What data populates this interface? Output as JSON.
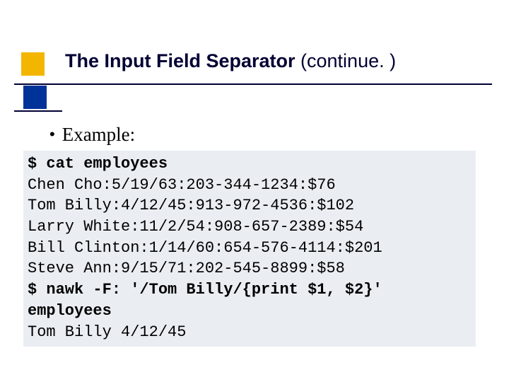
{
  "title": {
    "main": "The Input Field Separator",
    "cont": " (continue. )"
  },
  "bullet": {
    "dot": "•",
    "text": "Example:"
  },
  "code": {
    "l0": "$ cat employees",
    "l1": "Chen Cho:5/19/63:203-344-1234:$76",
    "l2": "Tom Billy:4/12/45:913-972-4536:$102",
    "l3": "Larry White:11/2/54:908-657-2389:$54",
    "l4": "Bill Clinton:1/14/60:654-576-4114:$201",
    "l5": "Steve Ann:9/15/71:202-545-8899:$58",
    "l6a": "$ nawk -F: '/Tom Billy/{print $1, $2}'",
    "l6b": "employees",
    "l7": "Tom Billy 4/12/45"
  }
}
